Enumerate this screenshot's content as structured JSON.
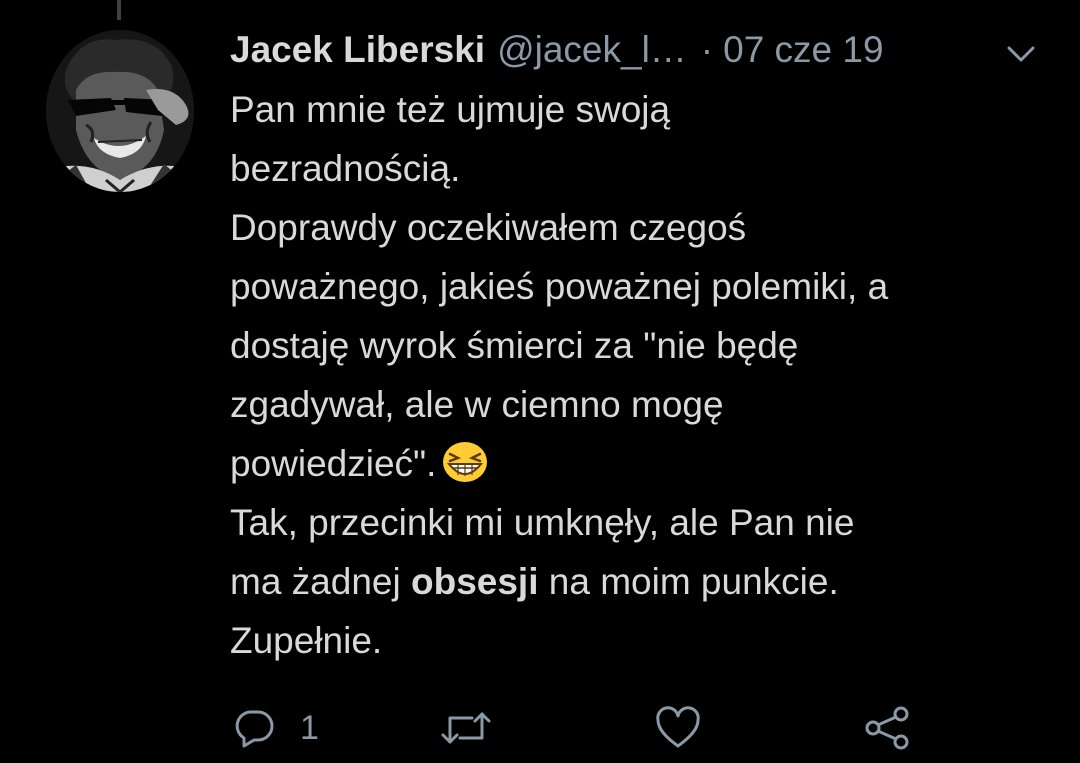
{
  "tweet": {
    "author": {
      "display_name": "Jacek Liberski",
      "handle": "@jacek_l…"
    },
    "separator": "·",
    "timestamp": "07 cze 19",
    "body_lines": [
      "Pan mnie też ujmuje swoją",
      "bezradnością.",
      "Doprawdy oczekiwałem czegoś",
      "poważnego, jakieś poważnej polemiki, a",
      "dostaję wyrok śmierci za \"nie będę",
      "zgadywał, ale w ciemno mogę"
    ],
    "emoji_line_text": "powiedzieć\".",
    "emoji_icon": "grinning-squinting-face-emoji",
    "line_tak": "Tak, przecinki mi umknęły, ale Pan nie",
    "bold_line": {
      "before": "ma żadnej ",
      "bold": "obsesji",
      "after": " na moim punkcie."
    },
    "last_line": "Zupełnie.",
    "actions": {
      "reply_count": "1",
      "reply_icon": "reply-icon",
      "retweet_icon": "retweet-icon",
      "like_icon": "heart-icon",
      "share_icon": "share-icon"
    }
  },
  "colors": {
    "background": "#000000",
    "text": "#d9d9d9",
    "muted": "#8b98a5",
    "thread_line": "#3d4247",
    "emoji_yellow": "#ffcc33"
  }
}
